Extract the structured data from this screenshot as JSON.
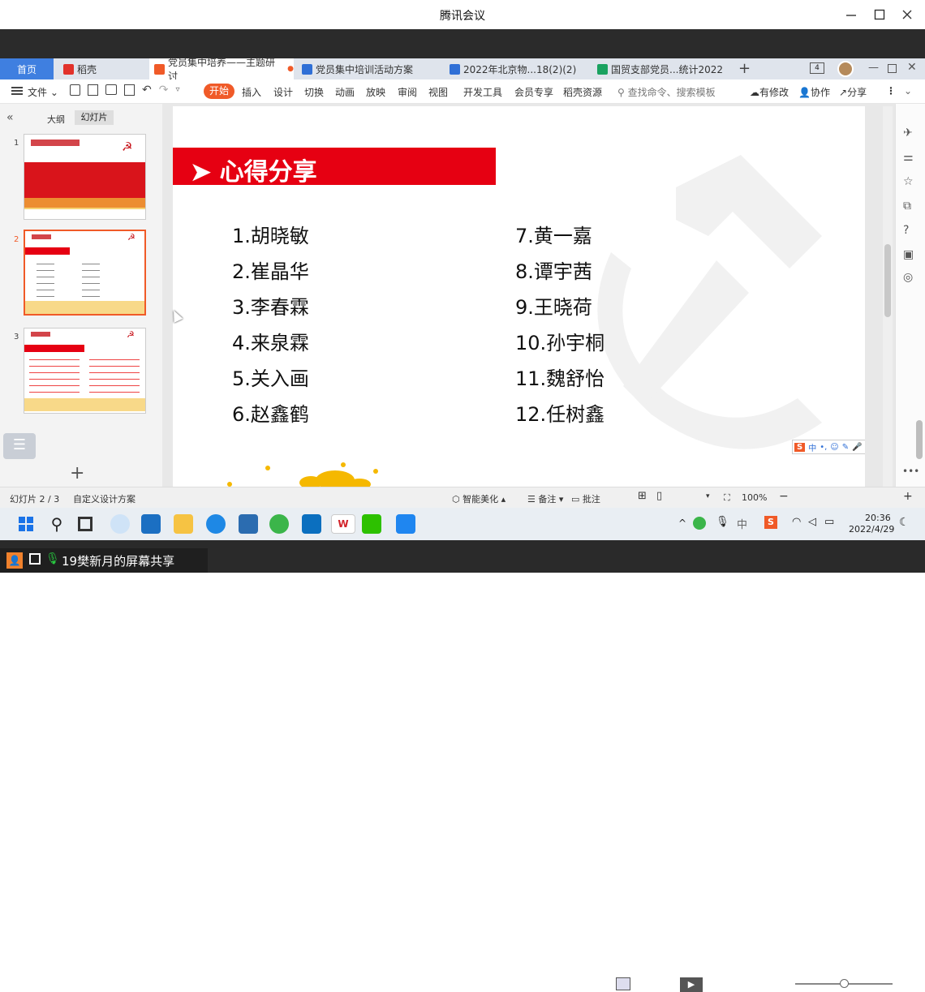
{
  "meeting": {
    "title": "腾讯会议"
  },
  "tabs": [
    {
      "label": "首页"
    },
    {
      "label": "稻壳"
    },
    {
      "label": "党员集中培养——主题研讨"
    },
    {
      "label": "党员集中培训活动方案"
    },
    {
      "label": "2022年北京物...18(2)(2)"
    },
    {
      "label": "国贸支部党员...统计2022"
    }
  ],
  "tabbar": {
    "window_count": "4"
  },
  "toolbar": {
    "file": "文件",
    "menus": [
      "开始",
      "插入",
      "设计",
      "切换",
      "动画",
      "放映",
      "审阅",
      "视图",
      "开发工具",
      "会员专享",
      "稻壳资源"
    ],
    "search_placeholder": "查找命令、搜索模板",
    "modified": "有修改",
    "collab": "协作",
    "share": "分享"
  },
  "leftpanel": {
    "outline": "大纲",
    "slides": "幻灯片",
    "numbers": [
      "1",
      "2",
      "3"
    ]
  },
  "slide": {
    "header": "➤ 心得分享",
    "names_left": [
      "1.胡晓敏",
      "2.崔晶华",
      "3.李春霖",
      "4.来泉霖",
      "5.关入画",
      "6.赵鑫鹤"
    ],
    "names_right": [
      "7.黄一嘉",
      "8.谭宇茜",
      "9.王晓荷",
      "10.孙宇桐",
      "11.魏舒怡",
      "12.任树鑫"
    ]
  },
  "status": {
    "slide_pos": "幻灯片 2 / 3",
    "design": "自定义设计方案",
    "beautify": "智能美化",
    "notes": "备注",
    "annotate": "批注",
    "zoom": "100%"
  },
  "taskbar": {
    "time": "20:36",
    "date": "2022/4/29"
  },
  "share": {
    "label": "19樊新月的屏幕共享"
  },
  "colors": {
    "accent_red": "#e60012",
    "wps_orange": "#f05a28",
    "tabbar": "#dfe4ec"
  }
}
